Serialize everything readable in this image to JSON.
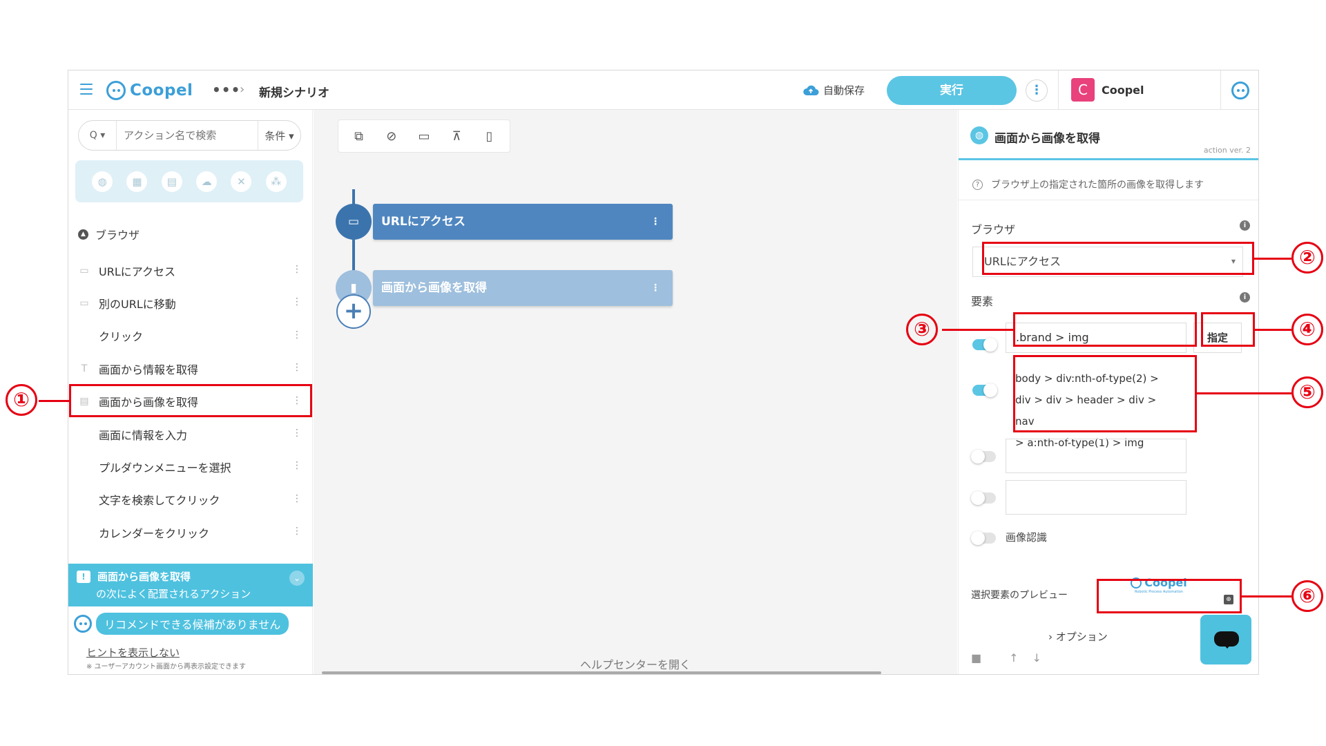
{
  "header": {
    "brand": "Coopel",
    "more": "•••",
    "crumb_sep": "›",
    "title": "新規シナリオ",
    "autosave": "自動保存",
    "run": "実行",
    "kebab": "⋮",
    "avatar_letter": "C",
    "user": "Coopel"
  },
  "sidebar": {
    "search_placeholder": "アクション名で検索",
    "search_icon": "Q ▾",
    "filter": "条件 ▾",
    "categories": [
      "globe-icon",
      "excel-icon",
      "file-icon",
      "cloud-icon",
      "tools-icon",
      "network-icon"
    ],
    "section": "ブラウザ",
    "items": [
      {
        "label": "URLにアクセス",
        "icon": "window-icon"
      },
      {
        "label": "別のURLに移動",
        "icon": "window-icon"
      },
      {
        "label": "クリック",
        "icon": "cursor-icon"
      },
      {
        "label": "画面から情報を取得",
        "icon": "text-icon"
      },
      {
        "label": "画面から画像を取得",
        "icon": "file-icon"
      },
      {
        "label": "画面に情報を入力",
        "icon": "keyboard-icon"
      },
      {
        "label": "プルダウンメニューを選択",
        "icon": "menu-icon"
      },
      {
        "label": "文字を検索してクリック",
        "icon": "search-click-icon"
      },
      {
        "label": "カレンダーをクリック",
        "icon": "calendar-icon"
      }
    ],
    "reco_title": "画面から画像を取得",
    "reco_sub": "の次によく配置されるアクション",
    "bubble": "リコメンドできる候補がありません",
    "hint_link": "ヒントを表示しない",
    "hint_note": "※ ユーザーアカウント画面から再表示設定できます"
  },
  "canvas": {
    "nodes": [
      {
        "label": "URLにアクセス",
        "color": "#4f86c0"
      },
      {
        "label": "画面から画像を取得",
        "color": "#9ebfdd"
      }
    ],
    "add": "+",
    "help": "ヘルプセンターを開く"
  },
  "panel": {
    "title": "画面から画像を取得",
    "version": "action ver. 2",
    "desc": "ブラウザ上の指定された箇所の画像を取得します",
    "browser_label": "ブラウザ",
    "browser_value": "URLにアクセス",
    "element_label": "要素",
    "selector1": ".brand > img",
    "spec_button": "指定",
    "selector2_lines": [
      "body > div:nth-of-type(2) >",
      "div > div > header > div > nav",
      "> a:nth-of-type(1) > img"
    ],
    "image_recog": "画像認識",
    "preview_label": "選択要素のプレビュー",
    "preview_brand": "Coopel",
    "preview_tag": "Robotic Process Automation",
    "options": "› オプション"
  },
  "annotations": [
    "①",
    "②",
    "③",
    "④",
    "⑤",
    "⑥"
  ],
  "colors": {
    "accent": "#5bc5e4",
    "brand": "#3c9fd8",
    "annotation": "#e60012"
  }
}
